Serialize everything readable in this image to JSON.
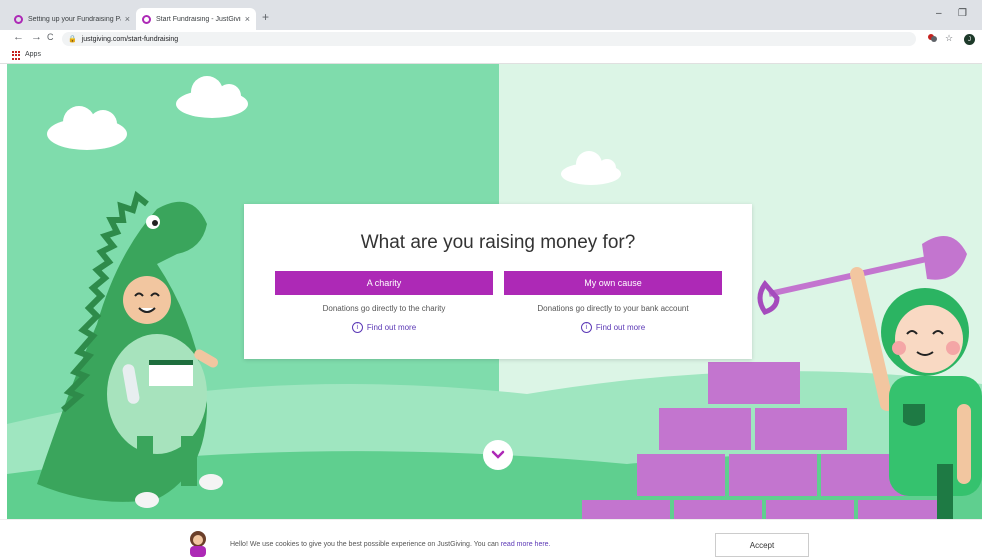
{
  "browser": {
    "tabs": [
      {
        "title": "Setting up your Fundraising Page",
        "close": "×"
      },
      {
        "title": "Start Fundraising - JustGiving",
        "close": "×"
      }
    ],
    "new_tab": "+",
    "minimize": "–",
    "restore": "❐",
    "back": "←",
    "forward": "→",
    "reload": "C",
    "lock": "🔒",
    "url": "justgiving.com/start-fundraising",
    "star": "☆",
    "profile_initial": "J",
    "bookmarks_apps": "Apps"
  },
  "modal": {
    "title": "What are you raising money for?",
    "choices": [
      {
        "label": "A charity",
        "description": "Donations go directly to the charity",
        "link": "Find out more"
      },
      {
        "label": "My own cause",
        "description": "Donations go directly to your bank account",
        "link": "Find out more"
      }
    ],
    "info_glyph": "i"
  },
  "cookie": {
    "text": "Hello! We use cookies to give you the best possible experience on JustGiving. You can ",
    "link": "read more here.",
    "accept": "Accept"
  },
  "colors": {
    "brand_purple": "#ad29b6",
    "link_purple": "#5c39b6",
    "left_bg": "#7fdcac",
    "right_bg": "#dcf5e6",
    "dino_green": "#3aa55c",
    "brick": "#c375cf"
  }
}
